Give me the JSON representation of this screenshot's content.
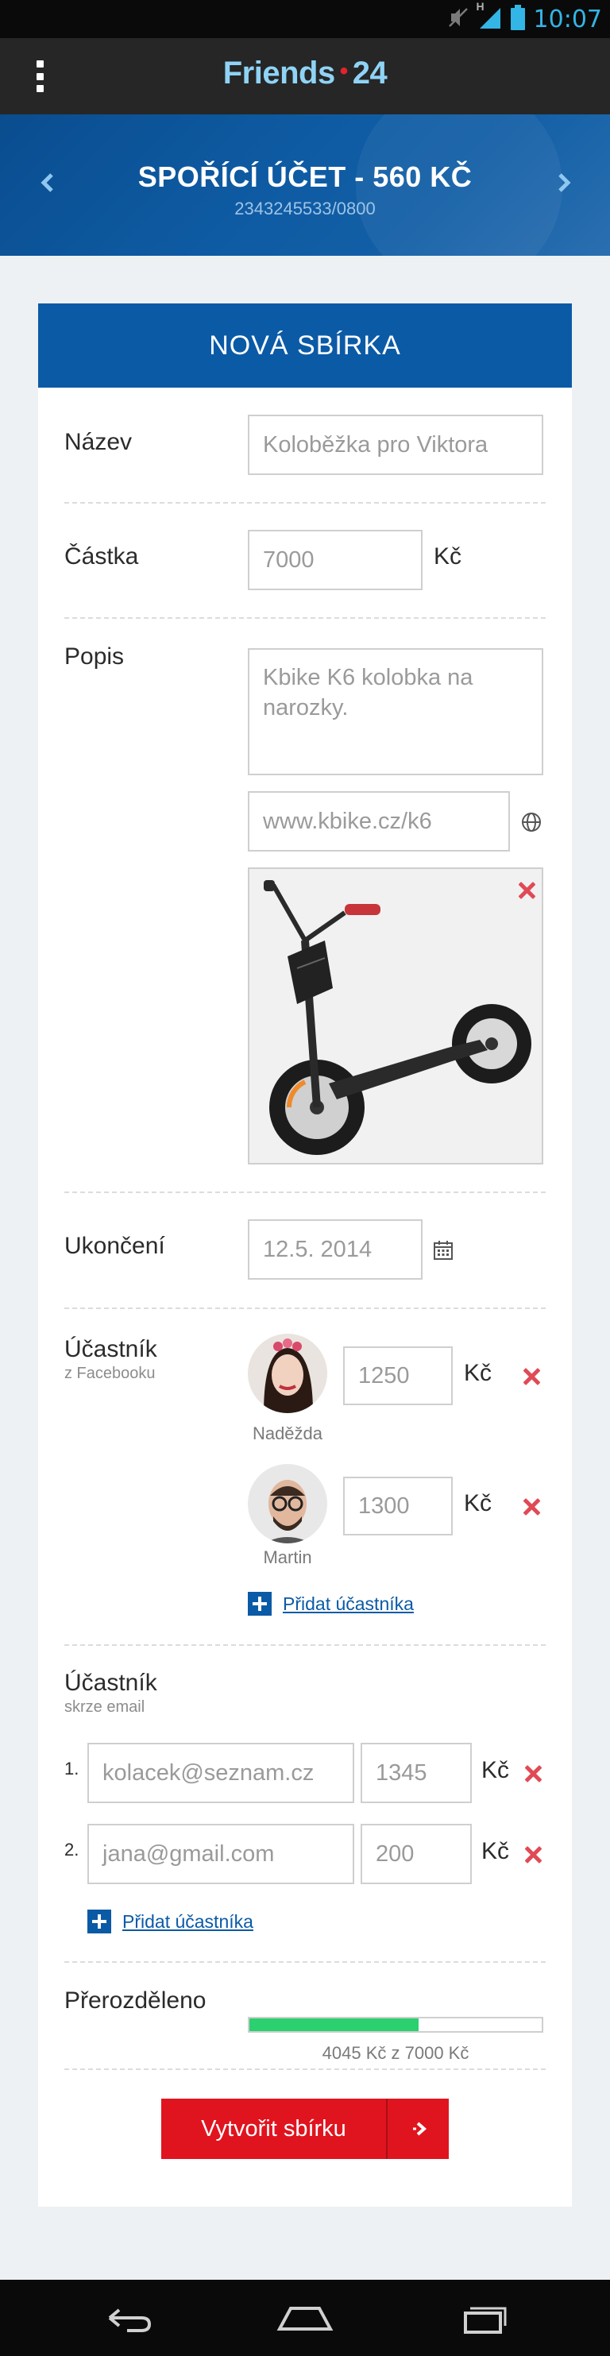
{
  "status_bar": {
    "time": "10:07",
    "network": "H",
    "icons": [
      "mute-icon",
      "signal-icon",
      "battery-icon"
    ]
  },
  "appbar": {
    "brand_left": "Friends",
    "brand_dot": "•",
    "brand_right": "24",
    "menu_icon": "overflow-menu-icon"
  },
  "account": {
    "title": "SPOŘÍCÍ ÚČET - 560 KČ",
    "number": "2343245533/0800",
    "prev_icon": "chevron-left-icon",
    "next_icon": "chevron-right-icon"
  },
  "form": {
    "heading": "NOVÁ SBÍRKA",
    "name_label": "Název",
    "name_value": "Koloběžka pro Viktora",
    "amount_label": "Částka",
    "amount_value": "7000",
    "currency": "Kč",
    "description_label": "Popis",
    "description_value": "Kbike K6 kolobka na narozky.",
    "link_value": "www.kbike.cz/k6",
    "link_icon": "globe-icon",
    "image_remove_icon": "close-icon",
    "end_label": "Ukončení",
    "end_value": "12.5. 2014",
    "calendar_icon": "calendar-icon",
    "fb_label": "Účastník",
    "fb_sub": "z Facebooku",
    "fb_participants": [
      {
        "name": "Naděžda",
        "amount": "1250",
        "currency": "Kč"
      },
      {
        "name": "Martin",
        "amount": "1300",
        "currency": "Kč"
      }
    ],
    "add_participant": "Přidat účastníka",
    "email_label": "Účastník",
    "email_sub": "skrze email",
    "email_participants": [
      {
        "index": "1.",
        "email": "kolacek@seznam.cz",
        "amount": "1345",
        "currency": "Kč"
      },
      {
        "index": "2.",
        "email": "jana@gmail.com",
        "amount": "200",
        "currency": "Kč"
      }
    ],
    "add_participant_email": "Přidat účastníka",
    "distributed_label": "Přerozděleno",
    "distributed_text": "4045 Kč z 7000 Kč",
    "distributed_fraction": 0.578,
    "submit_label": "Vytvořit sbírku",
    "submit_icon": "arrow-right-icon"
  },
  "colors": {
    "brand_blue": "#0b5aa6",
    "accent_red": "#e0141f",
    "progress_green": "#2bd06f",
    "remove_red": "#e04a55"
  },
  "navbar": {
    "icons": [
      "back-icon",
      "home-icon",
      "recents-icon"
    ]
  }
}
